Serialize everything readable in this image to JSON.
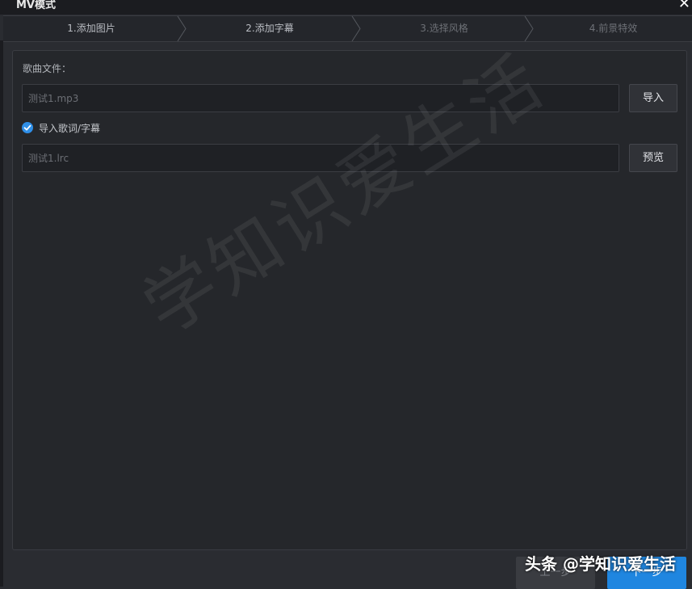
{
  "window": {
    "title": "MV模式",
    "close_glyph": "✕"
  },
  "steps": [
    {
      "label": "1.添加图片",
      "state": "done"
    },
    {
      "label": "2.添加字幕",
      "state": "done"
    },
    {
      "label": "3.选择风格",
      "state": "todo"
    },
    {
      "label": "4.前景特效",
      "state": "todo"
    }
  ],
  "song": {
    "label": "歌曲文件：",
    "file_value": "测试1.mp3",
    "import_button": "导入"
  },
  "lyrics": {
    "checkbox_label": "导入歌词/字幕",
    "checked": true,
    "file_value": "测试1.lrc",
    "preview_button": "预览"
  },
  "watermark_text": "学知识爱生活",
  "footer": {
    "prev_button": "上一步",
    "next_button": "下一步",
    "credit": "头条 @学知识爱生活"
  },
  "colors": {
    "accent": "#1f86e0",
    "checkbox": "#2f8fe8",
    "panel_bg": "#25272b",
    "window_bg": "#2a2c31"
  }
}
